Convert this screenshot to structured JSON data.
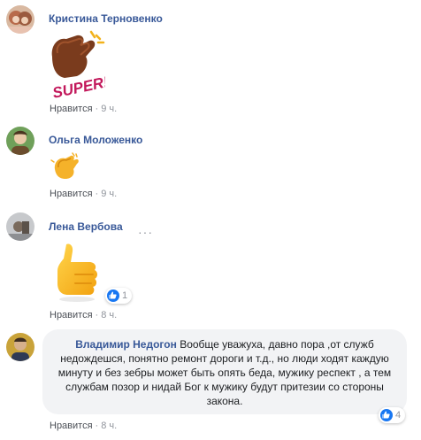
{
  "comments": [
    {
      "author": "Кристина Терновенко",
      "like_label": "Нравится",
      "separator": "·",
      "time": "9 ч.",
      "sticker": "clapping-hands-super-sticker",
      "sticker_text": "SUPER!"
    },
    {
      "author": "Ольга Моложенко",
      "like_label": "Нравится",
      "separator": "·",
      "time": "9 ч.",
      "sticker": "clapping-hands-emoji"
    },
    {
      "author": "Лена Вербова",
      "like_label": "Нравится",
      "separator": "·",
      "time": "8 ч.",
      "sticker": "thumbs-up-sticker",
      "reaction_count": "1",
      "more_options": "···"
    },
    {
      "author": "Владимир Недогон",
      "text": "Вообще уважуха, давно пора ,от служб недождешся, понятно ремонт дороги и т.д., но люди ходят каждую минуту и без зебры может быть опять беда, мужику респект , а тем службам позор и нидай Бог к мужику будут притезии со стороны закона.",
      "like_label": "Нравится",
      "separator": "·",
      "time": "8 ч.",
      "reaction_count": "4"
    }
  ],
  "colors": {
    "name_link": "#385898",
    "meta_text": "#90949c",
    "bubble_bg": "#f2f3f5",
    "like_blue": "#1877f2"
  }
}
